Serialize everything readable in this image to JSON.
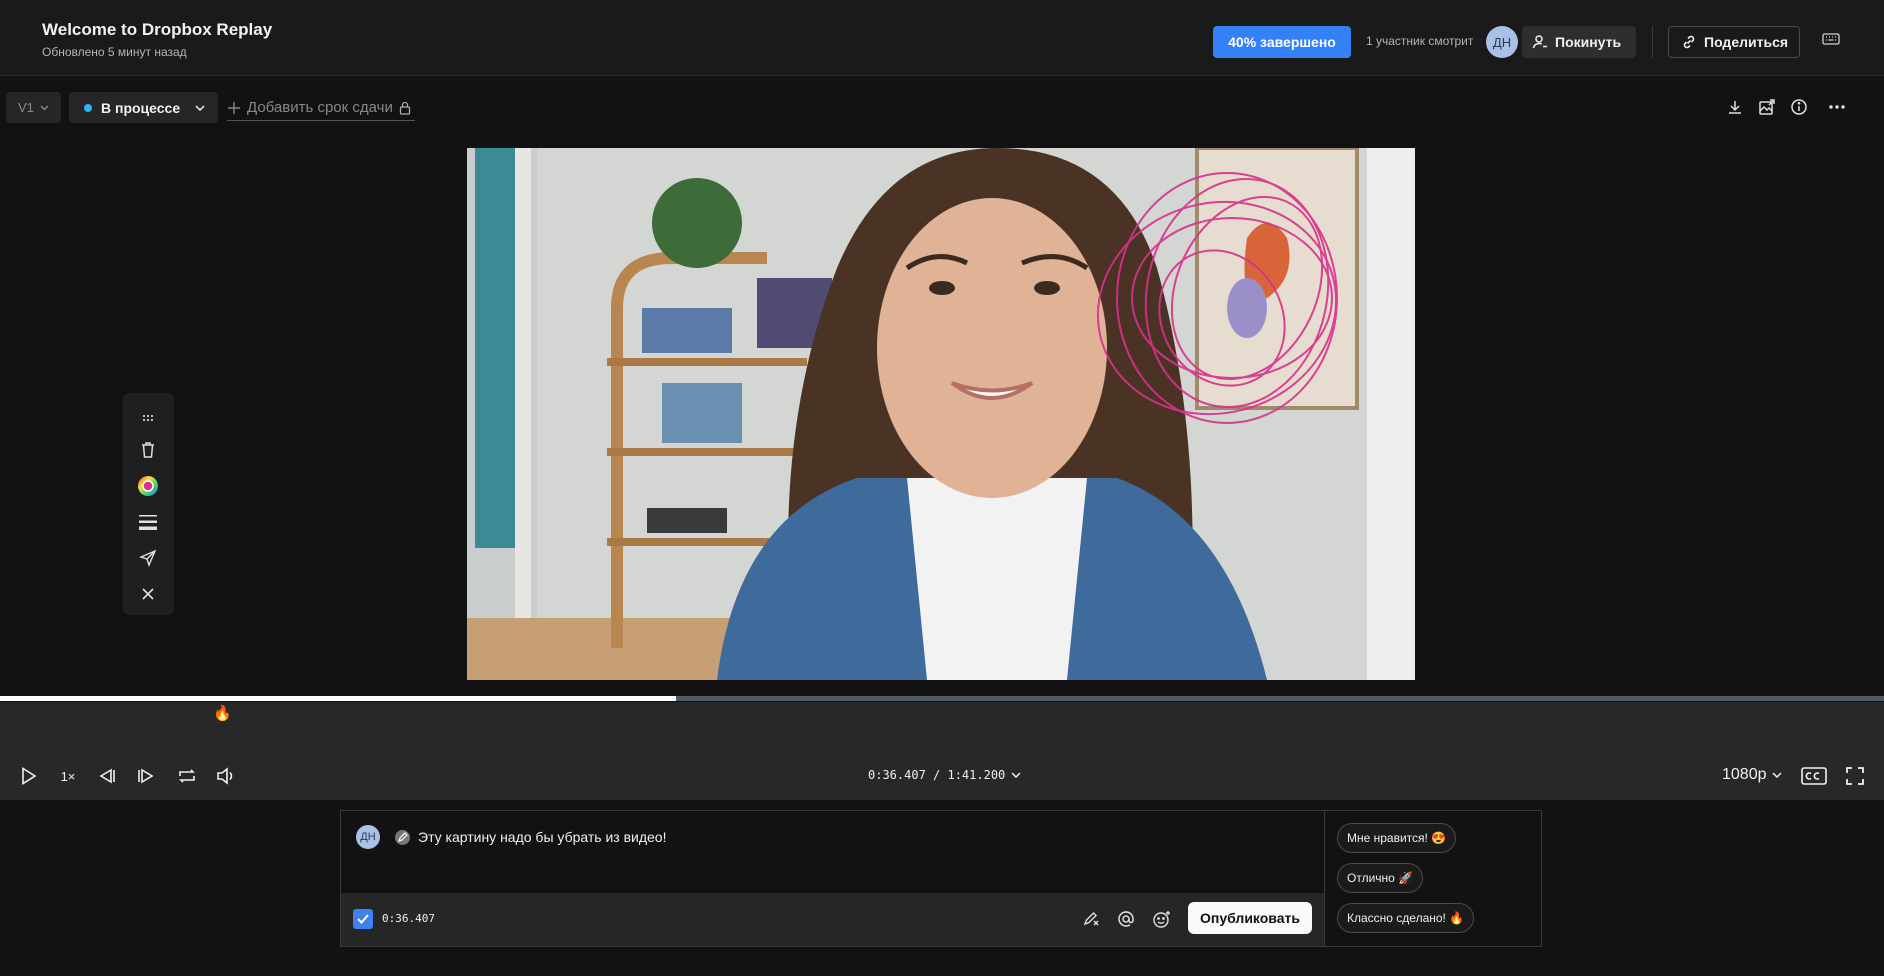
{
  "header": {
    "title": "Welcome to Dropbox Replay",
    "subtitle": "Обновлено 5 минут назад",
    "progress_label": "40% завершено",
    "viewers_label": "1 участник смотрит",
    "avatar_initials": "ДН",
    "leave_label": "Покинуть",
    "share_label": "Поделиться"
  },
  "toolbar": {
    "version_label": "V1",
    "status_label": "В процессе",
    "status_color": "#2fb5f5",
    "deadline_label": "Добавить срок сдачи"
  },
  "player": {
    "speed_label": "1×",
    "timecode": "0:36.407 / 1:41.200",
    "quality_label": "1080p",
    "progress_fraction": 0.359,
    "marker_emoji": "🔥"
  },
  "composer": {
    "avatar_initials": "ДН",
    "comment_text": "Эту картину надо бы убрать из видео!",
    "timestamp": "0:36.407",
    "publish_label": "Опубликовать"
  },
  "reactions": [
    "Мне нравится! 😍",
    "Отлично 🚀",
    "Классно сделано! 🔥"
  ],
  "colors": {
    "accent": "#3480f7",
    "annotation": "#d8318a"
  }
}
